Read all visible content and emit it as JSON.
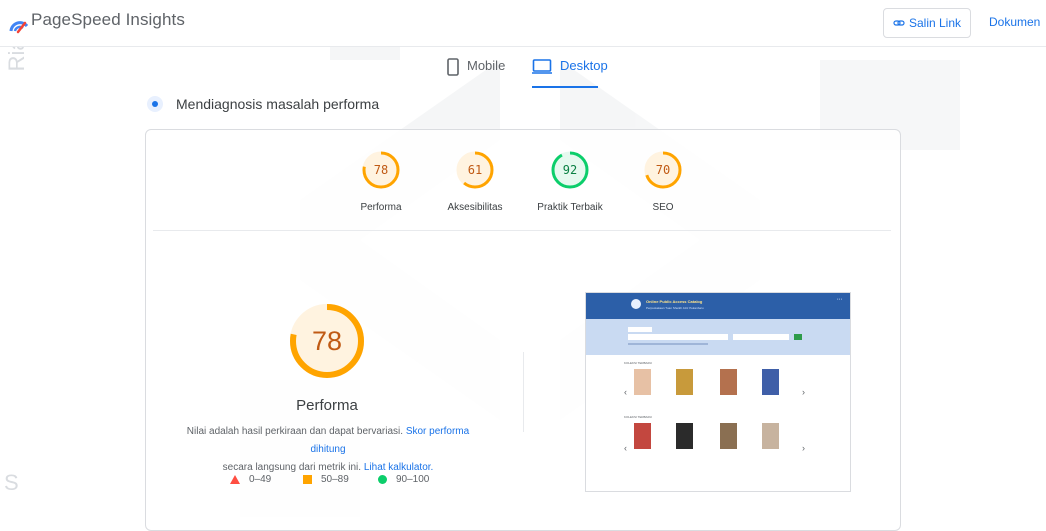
{
  "header": {
    "app_title": "PageSpeed Insights",
    "share_button": "Salin Link",
    "docs_link": "Dokumen"
  },
  "watermark": {
    "side_top": "Ria u",
    "side_bottom": "S"
  },
  "tabs": [
    {
      "label": "Mobile",
      "icon": "smartphone-icon",
      "active": false
    },
    {
      "label": "Desktop",
      "icon": "monitor-icon",
      "active": true
    }
  ],
  "diagnosis": {
    "label": "Mendiagnosis masalah performa"
  },
  "scores": [
    {
      "label": "Performa",
      "value": "78",
      "fraction": 0.78,
      "color": "#ffa400"
    },
    {
      "label": "Aksesibilitas",
      "value": "61",
      "fraction": 0.61,
      "color": "#ffa400"
    },
    {
      "label": "Praktik Terbaik",
      "value": "92",
      "fraction": 0.92,
      "color": "#0cce6b"
    },
    {
      "label": "SEO",
      "value": "70",
      "fraction": 0.7,
      "color": "#ffa400"
    }
  ],
  "main_score": {
    "value": "78",
    "fraction": 0.78,
    "label": "Performa"
  },
  "note": {
    "text1": "Nilai adalah hasil perkiraan dan dapat bervariasi. ",
    "link1": "Skor performa dihitung",
    "text2": "secara langsung dari metrik ini. ",
    "link2": "Lihat kalkulator."
  },
  "legend": [
    {
      "shape": "triangle",
      "range": "0–49",
      "color": "#ff4e42"
    },
    {
      "shape": "square",
      "range": "50–89",
      "color": "#ffa400"
    },
    {
      "shape": "circle",
      "range": "90–100",
      "color": "#0cce6b"
    }
  ],
  "thumbnail": {
    "site_title": "Online Public Access Catalog",
    "site_subtitle": "Perpustakaan Tuan Sheikh Aziz Pekanbaru",
    "section1": "KOLEKSI TERBARU",
    "section2": "KOLEKSI TERBARU"
  },
  "colors": {
    "accent": "#1a73e8",
    "average": "#ffa400",
    "pass": "#0cce6b",
    "fail": "#ff4e42"
  }
}
